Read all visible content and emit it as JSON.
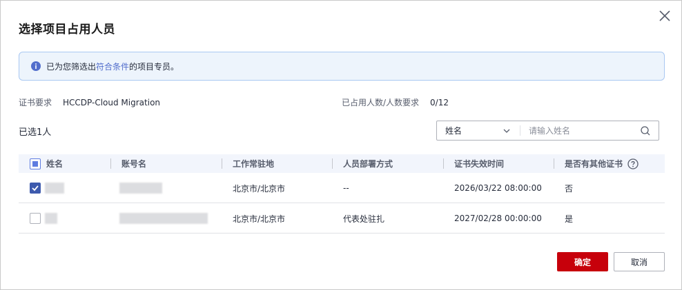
{
  "dialog": {
    "title": "选择项目占用人员",
    "info": {
      "prefix": "已为您筛选出",
      "link": "符合条件",
      "suffix": "的项目专员。"
    },
    "cert_label": "证书要求",
    "cert_value": "HCCDP-Cloud Migration",
    "occupy_label": "已占用人数/人数要求",
    "occupy_value": "0/12",
    "selected_text": "已选1人",
    "search": {
      "field": "姓名",
      "placeholder": "请输入姓名"
    },
    "table": {
      "headers": [
        "姓名",
        "账号名",
        "工作常驻地",
        "人员部署方式",
        "证书失效时间",
        "是否有其他证书"
      ],
      "rows": [
        {
          "checked": true,
          "location": "北京市/北京市",
          "deploy": "--",
          "expiry": "2026/03/22 08:00:00",
          "other_cert": "否"
        },
        {
          "checked": false,
          "location": "北京市/北京市",
          "deploy": "代表处驻扎",
          "expiry": "2027/02/28 00:00:00",
          "other_cert": "是"
        }
      ]
    },
    "buttons": {
      "ok": "确定",
      "cancel": "取消"
    }
  },
  "colors": {
    "primary_button": "#c7000b",
    "checkbox": "#3d5aad",
    "info_bg": "#edf4fc",
    "info_border": "#a9c8f2",
    "link": "#526ecc"
  },
  "icons": [
    "close-icon",
    "info-icon",
    "chevron-down-icon",
    "search-icon",
    "help-circle-icon"
  ]
}
